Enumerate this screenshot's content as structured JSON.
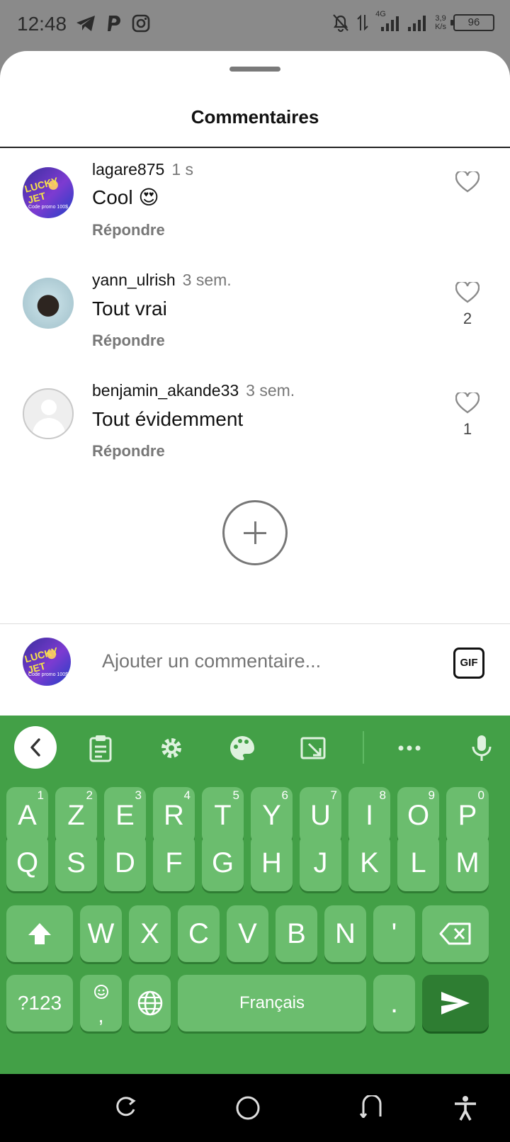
{
  "status_bar": {
    "time": "12:48",
    "left_icons": [
      "telegram-icon",
      "paypal-icon",
      "instagram-icon"
    ],
    "network": "4G",
    "speed_value": "3,9",
    "speed_unit": "K/s",
    "battery": "96"
  },
  "sheet": {
    "title": "Commentaires"
  },
  "comments": [
    {
      "username": "lagare875",
      "time": "1 s",
      "text": "Cool 😍",
      "reply": "Répondre",
      "likes": ""
    },
    {
      "username": "yann_ulrish",
      "time": "3 sem.",
      "text": "Tout vrai",
      "reply": "Répondre",
      "likes": "2"
    },
    {
      "username": "benjamin_akande33",
      "time": "3 sem.",
      "text": "Tout évidemment",
      "reply": "Répondre",
      "likes": "1"
    }
  ],
  "avatar_text": {
    "brand": "LUCKY JET",
    "promo": "Code promo 100$"
  },
  "emoji_bar": [
    "❤️",
    "🙌",
    "🔥",
    "👏",
    "😢",
    "😍",
    "😮",
    "😂"
  ],
  "input": {
    "placeholder": "Ajouter un commentaire...",
    "gif_label": "GIF"
  },
  "keyboard": {
    "row1": [
      {
        "key": "A",
        "hint": "1"
      },
      {
        "key": "Z",
        "hint": "2"
      },
      {
        "key": "E",
        "hint": "3"
      },
      {
        "key": "R",
        "hint": "4"
      },
      {
        "key": "T",
        "hint": "5"
      },
      {
        "key": "Y",
        "hint": "6"
      },
      {
        "key": "U",
        "hint": "7"
      },
      {
        "key": "I",
        "hint": "8"
      },
      {
        "key": "O",
        "hint": "9"
      },
      {
        "key": "P",
        "hint": "0"
      }
    ],
    "row2": [
      "Q",
      "S",
      "D",
      "F",
      "G",
      "H",
      "J",
      "K",
      "L",
      "M"
    ],
    "row3": [
      "W",
      "X",
      "C",
      "V",
      "B",
      "N",
      "'"
    ],
    "symbols_label": "?123",
    "comma_label": ",",
    "space_label": "Français",
    "period_label": ".",
    "accent_color": "#43a047"
  }
}
